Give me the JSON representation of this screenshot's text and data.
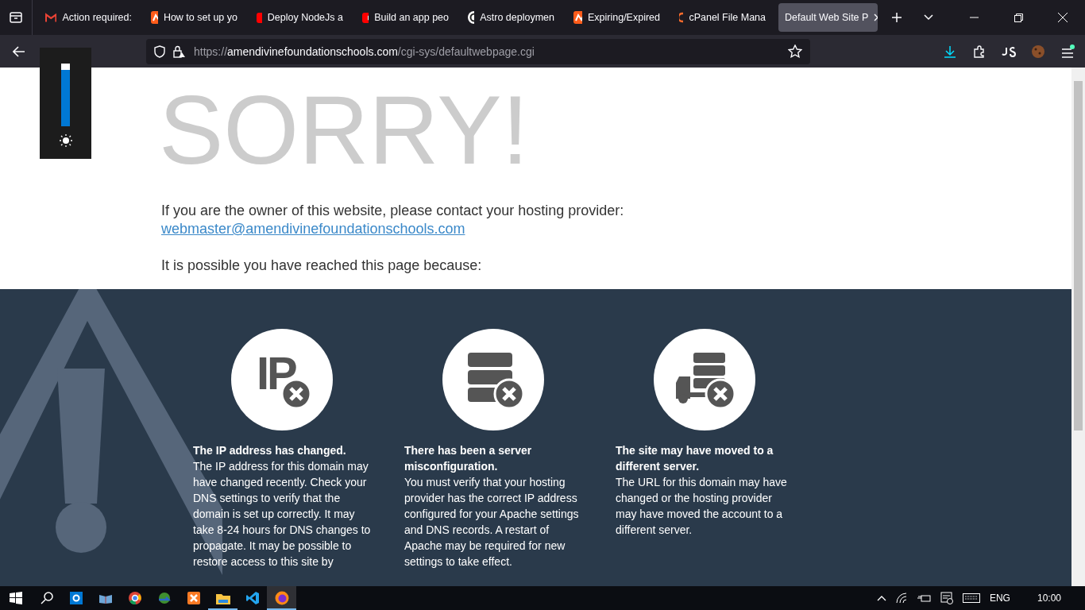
{
  "tabs": [
    {
      "title": "Action required:",
      "kind": "gmail",
      "selected": false
    },
    {
      "title": "How to set up yo",
      "kind": "orange",
      "selected": false
    },
    {
      "title": "Deploy NodeJs a",
      "kind": "youtube",
      "selected": false
    },
    {
      "title": "Build an app peo",
      "kind": "youtube",
      "selected": false
    },
    {
      "title": "Astro deploymen",
      "kind": "openai",
      "selected": false
    },
    {
      "title": "Expiring/Expired",
      "kind": "orange",
      "selected": false
    },
    {
      "title": "cPanel File Mana",
      "kind": "cpanel",
      "selected": false
    },
    {
      "title": "Default Web Site P",
      "kind": "plain",
      "selected": true
    }
  ],
  "address": {
    "scheme": "https://",
    "host": "amendivinefoundationschools.com",
    "path": "/cgi-sys/defaultwebpage.cgi"
  },
  "brightness": {
    "level": 0.9
  },
  "page": {
    "heading": "SORRY!",
    "owner_text": "If you are the owner of this website, please contact your hosting provider:",
    "email": "webmaster@amendivinefoundationschools.com",
    "reason_intro": "It is possible you have reached this page because:",
    "reasons": [
      {
        "kind": "ip",
        "icon_text": "IP",
        "title": "The IP address has changed.",
        "body": "The IP address for this domain may have changed recently. Check your DNS settings to verify that the domain is set up correctly. It may take 8-24 hours for DNS changes to propagate. It may be possible to restore access to this site by"
      },
      {
        "kind": "server",
        "title": "There has been a server misconfiguration.",
        "body": "You must verify that your hosting provider has the correct IP address configured for your Apache settings and DNS records. A restart of Apache may be required for new settings to take effect."
      },
      {
        "kind": "truck",
        "title": "The site may have moved to a different server.",
        "body": "The URL for this domain may have changed or the hosting provider may have moved the account to a different server."
      }
    ]
  },
  "taskbar": {
    "apps": [
      {
        "kind": "settings",
        "running": false,
        "selected": false
      },
      {
        "kind": "book",
        "running": false,
        "selected": false
      },
      {
        "kind": "chrome",
        "running": false,
        "selected": false
      },
      {
        "kind": "globe",
        "running": false,
        "selected": false
      },
      {
        "kind": "xampp",
        "running": false,
        "selected": false
      },
      {
        "kind": "folder",
        "running": true,
        "selected": false
      },
      {
        "kind": "vscode",
        "running": false,
        "selected": false
      },
      {
        "kind": "firefox",
        "running": true,
        "selected": true
      }
    ],
    "language": "ENG",
    "time": "10:00"
  }
}
